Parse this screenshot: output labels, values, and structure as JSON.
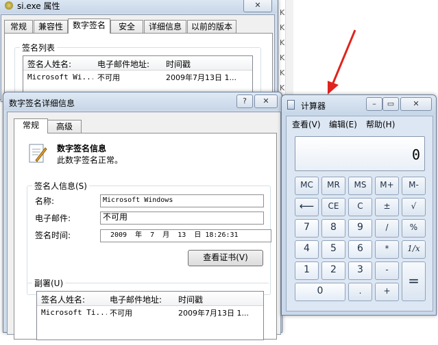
{
  "background": {
    "kb_labels": [
      "KB",
      "KB",
      "KB",
      "KB",
      "KB",
      "KB"
    ]
  },
  "properties_window": {
    "title": "si.exe 属性",
    "tabs": [
      "常规",
      "兼容性",
      "数字签名",
      "安全",
      "详细信息",
      "以前的版本"
    ],
    "active_tab": "数字签名",
    "signature_list_label": "签名列表",
    "columns": [
      "签名人姓名:",
      "电子邮件地址:",
      "时间戳"
    ],
    "rows": [
      {
        "name": "Microsoft Wi...",
        "email": "不可用",
        "timestamp": "2009年7月13日 1..."
      }
    ]
  },
  "details_dialog": {
    "title": "数字签名详细信息",
    "help_label": "?",
    "close_label": "✕",
    "tabs": [
      "常规",
      "高级"
    ],
    "info_title": "数字签名信息",
    "info_status": "此数字签名正常。",
    "signer_group_label": "签名人信息(S)",
    "name_label": "名称:",
    "name_value": "Microsoft Windows",
    "email_label": "电子邮件:",
    "email_value": "不可用",
    "time_label": "签名时间:",
    "time_value": "2009  年  7  月  13  日 18:26:31",
    "view_cert_button": "查看证书(V)",
    "countersign_label": "副署(U)",
    "columns": [
      "签名人姓名:",
      "电子邮件地址:",
      "时间戳"
    ],
    "rows": [
      {
        "name": "Microsoft Ti...",
        "email": "不可用",
        "timestamp": "2009年7月13日 1..."
      }
    ]
  },
  "calculator": {
    "title": "计算器",
    "menu": [
      "查看(V)",
      "编辑(E)",
      "帮助(H)"
    ],
    "display": "0",
    "keys": {
      "mc": "MC",
      "mr": "MR",
      "ms": "MS",
      "mplus": "M+",
      "mminus": "M-",
      "back": "⟵",
      "ce": "CE",
      "c": "C",
      "pm": "±",
      "sqrt": "√",
      "k7": "7",
      "k8": "8",
      "k9": "9",
      "div": "/",
      "pct": "%",
      "k4": "4",
      "k5": "5",
      "k6": "6",
      "mul": "*",
      "inv": "1/x",
      "k1": "1",
      "k2": "2",
      "k3": "3",
      "sub": "-",
      "eq": "=",
      "k0": "0",
      "dot": ".",
      "add": "+"
    }
  }
}
